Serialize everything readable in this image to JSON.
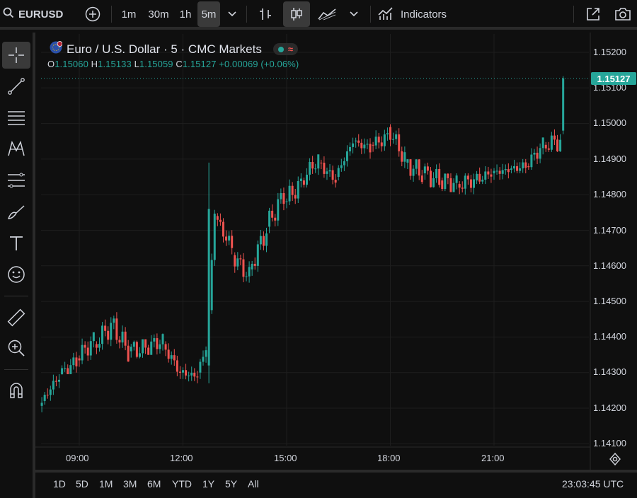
{
  "header": {
    "symbol": "EURUSD",
    "timeframes": [
      {
        "label": "1m",
        "active": false
      },
      {
        "label": "30m",
        "active": false
      },
      {
        "label": "1h",
        "active": false
      },
      {
        "label": "5m",
        "active": true
      }
    ],
    "indicators_label": "Indicators",
    "icons": [
      "search-icon",
      "add-symbol-icon",
      "chevron-down-icon",
      "bar-style-icon",
      "candle-style-icon",
      "area-style-icon",
      "indicators-icon",
      "open-new-window-icon",
      "camera-icon"
    ]
  },
  "left_tools": [
    "crosshair-icon",
    "trend-line-icon",
    "horizontal-lines-icon",
    "pattern-icon",
    "fib-icon",
    "brush-icon",
    "text-icon",
    "emoji-icon",
    "ruler-icon",
    "zoom-in-icon",
    "magnet-icon"
  ],
  "legend": {
    "title": "Euro / U.S. Dollar · 5 · CMC Markets",
    "open_label": "O",
    "open": "1.15060",
    "high_label": "H",
    "high": "1.15133",
    "low_label": "L",
    "low": "1.15059",
    "close_label": "C",
    "close": "1.15127",
    "change": "+0.00069 (+0.06%)",
    "pill_symbol": "≈"
  },
  "price_axis": {
    "labels": [
      "1.15200",
      "1.15100",
      "1.15000",
      "1.14900",
      "1.14800",
      "1.14700",
      "1.14600",
      "1.14500",
      "1.14400",
      "1.14300",
      "1.14200",
      "1.14100"
    ],
    "last_price": "1.15127"
  },
  "time_axis": {
    "labels": [
      "09:00",
      "12:00",
      "15:00",
      "18:00",
      "21:00"
    ]
  },
  "footer": {
    "ranges": [
      "1D",
      "5D",
      "1M",
      "3M",
      "6M",
      "YTD",
      "1Y",
      "5Y",
      "All"
    ],
    "clock": "23:03:45 UTC"
  },
  "colors": {
    "up": "#26a69a",
    "down": "#ef5350",
    "background": "#0f0f0f",
    "grid": "#1e1e1e"
  },
  "chart_data": {
    "type": "candlestick",
    "symbol": "EURUSD",
    "interval": "5m",
    "ylim": [
      1.1408,
      1.1523
    ],
    "xlim": [
      "07:30",
      "23:30"
    ],
    "series": [
      {
        "t": "07:30",
        "o": 1.14195,
        "h": 1.1423,
        "l": 1.1418,
        "c": 1.14215
      },
      {
        "t": "08:00",
        "o": 1.1422,
        "h": 1.143,
        "l": 1.1421,
        "c": 1.1429
      },
      {
        "t": "08:30",
        "o": 1.14295,
        "h": 1.1434,
        "l": 1.143,
        "c": 1.1433
      },
      {
        "t": "09:00",
        "o": 1.1434,
        "h": 1.1441,
        "l": 1.1431,
        "c": 1.1439
      },
      {
        "t": "09:30",
        "o": 1.1438,
        "h": 1.1446,
        "l": 1.1434,
        "c": 1.1443
      },
      {
        "t": "10:00",
        "o": 1.1444,
        "h": 1.1447,
        "l": 1.1433,
        "c": 1.1436
      },
      {
        "t": "10:30",
        "o": 1.1436,
        "h": 1.1439,
        "l": 1.1434,
        "c": 1.1437
      },
      {
        "t": "11:00",
        "o": 1.1437,
        "h": 1.1441,
        "l": 1.1435,
        "c": 1.1439
      },
      {
        "t": "11:30",
        "o": 1.1438,
        "h": 1.144,
        "l": 1.1429,
        "c": 1.143
      },
      {
        "t": "12:00",
        "o": 1.143,
        "h": 1.1433,
        "l": 1.1427,
        "c": 1.1429
      },
      {
        "t": "12:30",
        "o": 1.143,
        "h": 1.1439,
        "l": 1.1427,
        "c": 1.1437
      },
      {
        "t": "12:45",
        "o": 1.1432,
        "h": 1.1489,
        "l": 1.1427,
        "c": 1.1476
      },
      {
        "t": "13:00",
        "o": 1.1474,
        "h": 1.1475,
        "l": 1.1462,
        "c": 1.1465
      },
      {
        "t": "13:30",
        "o": 1.1463,
        "h": 1.1465,
        "l": 1.1454,
        "c": 1.1457
      },
      {
        "t": "14:00",
        "o": 1.1459,
        "h": 1.1472,
        "l": 1.1456,
        "c": 1.147
      },
      {
        "t": "14:30",
        "o": 1.1471,
        "h": 1.1482,
        "l": 1.1468,
        "c": 1.148
      },
      {
        "t": "15:00",
        "o": 1.1478,
        "h": 1.1486,
        "l": 1.1476,
        "c": 1.1483
      },
      {
        "t": "15:30",
        "o": 1.1484,
        "h": 1.1491,
        "l": 1.1482,
        "c": 1.149
      },
      {
        "t": "16:00",
        "o": 1.1489,
        "h": 1.1491,
        "l": 1.1482,
        "c": 1.1484
      },
      {
        "t": "16:30",
        "o": 1.1485,
        "h": 1.1497,
        "l": 1.1484,
        "c": 1.1495
      },
      {
        "t": "17:00",
        "o": 1.1495,
        "h": 1.1497,
        "l": 1.149,
        "c": 1.1493
      },
      {
        "t": "17:30",
        "o": 1.1494,
        "h": 1.1499,
        "l": 1.1491,
        "c": 1.1496
      },
      {
        "t": "18:00",
        "o": 1.1499,
        "h": 1.15,
        "l": 1.1488,
        "c": 1.149
      },
      {
        "t": "18:30",
        "o": 1.1489,
        "h": 1.149,
        "l": 1.1483,
        "c": 1.1486
      },
      {
        "t": "19:00",
        "o": 1.1486,
        "h": 1.1489,
        "l": 1.1482,
        "c": 1.1484
      },
      {
        "t": "19:30",
        "o": 1.1484,
        "h": 1.1486,
        "l": 1.1482,
        "c": 1.1483
      },
      {
        "t": "20:00",
        "o": 1.1483,
        "h": 1.1485,
        "l": 1.148,
        "c": 1.1484
      },
      {
        "t": "20:30",
        "o": 1.1484,
        "h": 1.1488,
        "l": 1.1483,
        "c": 1.1486
      },
      {
        "t": "21:00",
        "o": 1.1486,
        "h": 1.149,
        "l": 1.1484,
        "c": 1.1487
      },
      {
        "t": "21:30",
        "o": 1.1487,
        "h": 1.1489,
        "l": 1.1486,
        "c": 1.1488
      },
      {
        "t": "22:00",
        "o": 1.1488,
        "h": 1.1495,
        "l": 1.1487,
        "c": 1.1494
      },
      {
        "t": "22:30",
        "o": 1.1494,
        "h": 1.1496,
        "l": 1.1492,
        "c": 1.1495
      },
      {
        "t": "23:00",
        "o": 1.1498,
        "h": 1.15133,
        "l": 1.1497,
        "c": 1.15127
      }
    ]
  }
}
